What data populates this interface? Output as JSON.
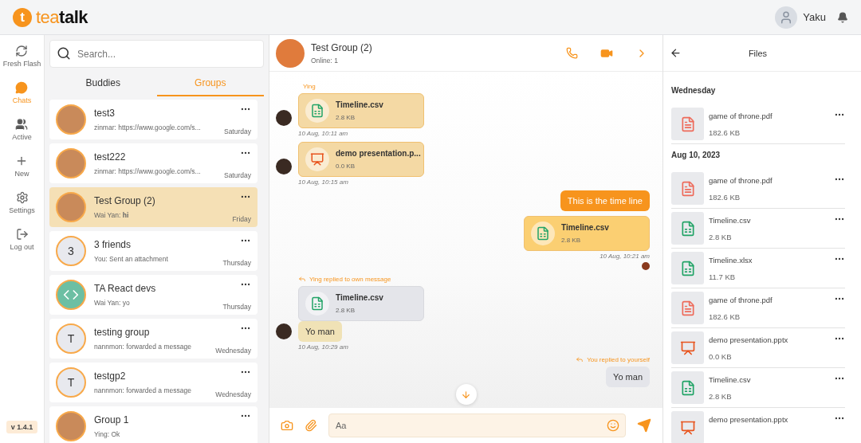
{
  "logo": {
    "accent": "tea",
    "rest": "talk",
    "mark": "t"
  },
  "user": {
    "name": "Yaku"
  },
  "nav": [
    {
      "label": "Fresh Flash",
      "kind": "flash",
      "selected": false
    },
    {
      "label": "Chats",
      "kind": "chat",
      "selected": true
    },
    {
      "label": "Active",
      "kind": "people",
      "selected": false
    },
    {
      "label": "New",
      "kind": "plus",
      "selected": false
    },
    {
      "label": "Settings",
      "kind": "gear",
      "selected": false
    },
    {
      "label": "Log out",
      "kind": "logout",
      "selected": false
    }
  ],
  "version": "v 1.4.1",
  "search": {
    "placeholder": "Search..."
  },
  "tabs": [
    {
      "label": "Buddies",
      "selected": false
    },
    {
      "label": "Groups",
      "selected": true
    }
  ],
  "conversations": [
    {
      "kind": "photo",
      "name": "test3",
      "preview": "zinmar: https://www.google.com/s...",
      "time": "Saturday",
      "selected": false
    },
    {
      "kind": "photo",
      "name": "test222",
      "preview": "zinmar: https://www.google.com/s...",
      "time": "Saturday",
      "selected": false
    },
    {
      "kind": "photo",
      "name": "Test Group (2)",
      "preview": "Wai Yan: **hi**",
      "time": "Friday",
      "selected": true
    },
    {
      "kind": "letter",
      "letter": "3",
      "name": "3 friends",
      "preview": "You: Sent an attachment",
      "time": "Thursday",
      "selected": false
    },
    {
      "kind": "code",
      "name": "TA React devs",
      "preview": "Wai Yan: yo",
      "time": "Thursday",
      "selected": false
    },
    {
      "kind": "letter",
      "letter": "T",
      "name": "testing group",
      "preview": "nannmon: forwarded a message",
      "time": "Wednesday",
      "selected": false
    },
    {
      "kind": "letter",
      "letter": "T",
      "name": "testgp2",
      "preview": "nannmon: forwarded a message",
      "time": "Wednesday",
      "selected": false
    },
    {
      "kind": "photo",
      "name": "Group 1",
      "preview": "Ying: Ok",
      "selected": false
    }
  ],
  "chat": {
    "title": "Test Group (2)",
    "status": "Online: 1"
  },
  "messages": [
    {
      "kind": "file_in",
      "sender": "Ying",
      "file": {
        "kind": "sheet",
        "name": "Timeline.csv",
        "size": "2.8 KB"
      },
      "time": "10 Aug, 10:11 am"
    },
    {
      "kind": "file_in",
      "file": {
        "kind": "slides",
        "name": "demo presentation.p...",
        "size": "0.0 KB"
      },
      "time": "10 Aug, 10:15 am"
    },
    {
      "kind": "text_out",
      "text": "This is the time line"
    },
    {
      "kind": "file_out",
      "file": {
        "kind": "sheet",
        "name": "Timeline.csv",
        "size": "2.8 KB"
      },
      "time": "10 Aug, 10:21 am",
      "seen": true
    },
    {
      "kind": "reply_in",
      "reply_label": "Ying replied to own message",
      "file": {
        "kind": "sheet",
        "name": "Timeline.csv",
        "size": "2.8 KB"
      },
      "text": "Yo man",
      "time": "10 Aug, 10:29 am"
    },
    {
      "kind": "reply_out",
      "reply_label": "You replied to yourself",
      "quoted_text": "Yo man"
    }
  ],
  "composer": {
    "placeholder": "Aa"
  },
  "files_panel": {
    "title": "Files",
    "groups": [
      {
        "date": "Wednesday",
        "files": [
          {
            "kind": "pdf",
            "name": "game of throne.pdf",
            "size": "182.6 KB"
          }
        ]
      },
      {
        "date": "Aug 10, 2023",
        "files": [
          {
            "kind": "pdf",
            "name": "game of throne.pdf",
            "size": "182.6 KB"
          },
          {
            "kind": "sheet",
            "name": "Timeline.csv",
            "size": "2.8 KB"
          },
          {
            "kind": "sheet",
            "name": "Timeline.xlsx",
            "size": "11.7 KB"
          },
          {
            "kind": "pdf",
            "name": "game of throne.pdf",
            "size": "182.6 KB"
          },
          {
            "kind": "slides",
            "name": "demo presentation.pptx",
            "size": "0.0 KB"
          },
          {
            "kind": "sheet",
            "name": "Timeline.csv",
            "size": "2.8 KB"
          },
          {
            "kind": "slides",
            "name": "demo presentation.pptx"
          }
        ]
      }
    ]
  }
}
